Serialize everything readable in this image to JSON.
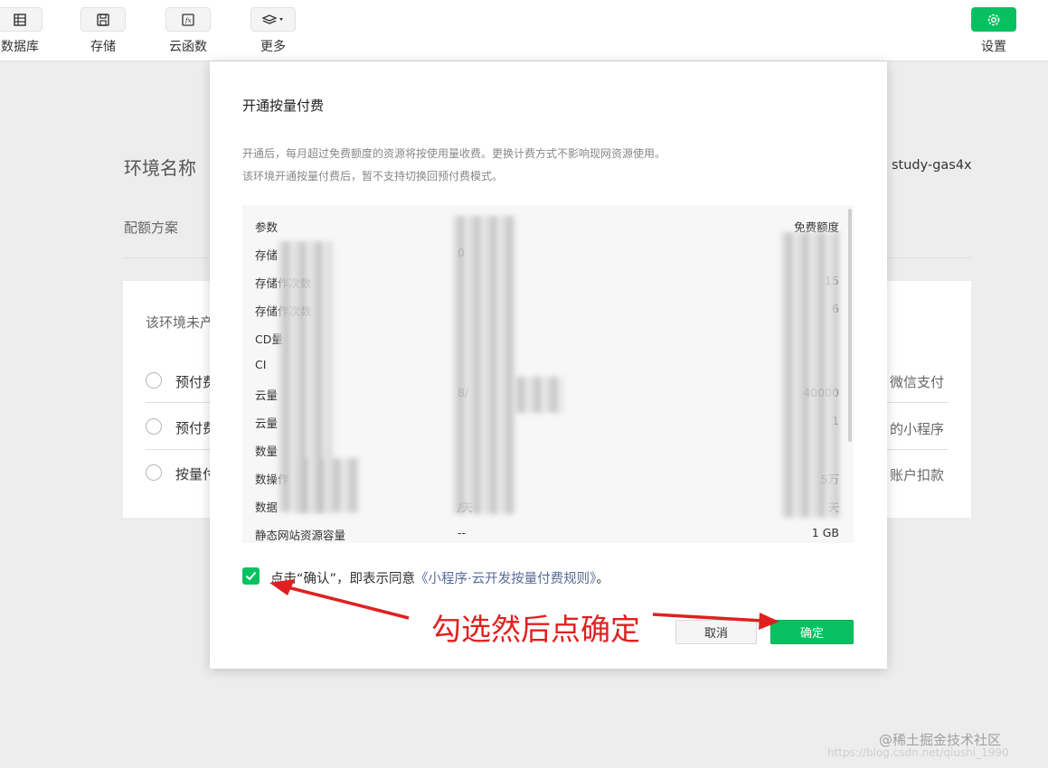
{
  "toolbar": {
    "database_label": "数据库",
    "storage_label": "存储",
    "cloudfunc_label": "云函数",
    "more_label": "更多",
    "settings_label": "设置"
  },
  "background": {
    "env_name_label": "环境名称",
    "env_name_value": "study-gas4x",
    "quota_label": "配额方案",
    "card_title": "该环境未产",
    "option1": "预付费",
    "option2": "预付费",
    "option3": "按量付",
    "option1_right": "微信支付",
    "option2_right": "的小程序",
    "option3_right": "账户扣款"
  },
  "modal": {
    "title": "开通按量付费",
    "desc_line1": "开通后，每月超过免费额度的资源将按使用量收费。更换计费方式不影响现网资源使用。",
    "desc_line2": "该环境开通按量付费后，暂不支持切换回预付费模式。",
    "table": {
      "header": {
        "param": "参数",
        "free": "免费额度"
      },
      "rows": [
        {
          "param": "存储",
          "value": "0",
          "free": ""
        },
        {
          "param": "存储作次数",
          "value": "",
          "free": "15"
        },
        {
          "param": "存储作次数",
          "value": "",
          "free": "6"
        },
        {
          "param": "CD量",
          "value": "",
          "free": ""
        },
        {
          "param": "CI",
          "value": "",
          "free": ""
        },
        {
          "param": "云量",
          "value": "8/",
          "free": "40000"
        },
        {
          "param": "云量",
          "value": "",
          "free": "1"
        },
        {
          "param": "数量",
          "value": "",
          "free": ""
        },
        {
          "param": "数操作",
          "value": "",
          "free": "5万"
        },
        {
          "param": "数据",
          "value": "/天",
          "free": "天"
        },
        {
          "param": "静态网站资源容量",
          "value": "--",
          "free": "1 GB"
        }
      ]
    },
    "agree_prefix": "点击“确认”，即表示同意",
    "agree_link": "《小程序·云开发按量付费规则》",
    "agree_suffix": "。",
    "cancel_label": "取消",
    "confirm_label": "确定"
  },
  "annotation": {
    "text": "勾选然后点确定"
  },
  "watermark": {
    "line1": "@稀土掘金技术社区",
    "line2": "https://blog.csdn.net/qiushi_1990"
  },
  "colors": {
    "primary": "#07c160",
    "link": "#576b95",
    "annotation": "#e02020"
  }
}
